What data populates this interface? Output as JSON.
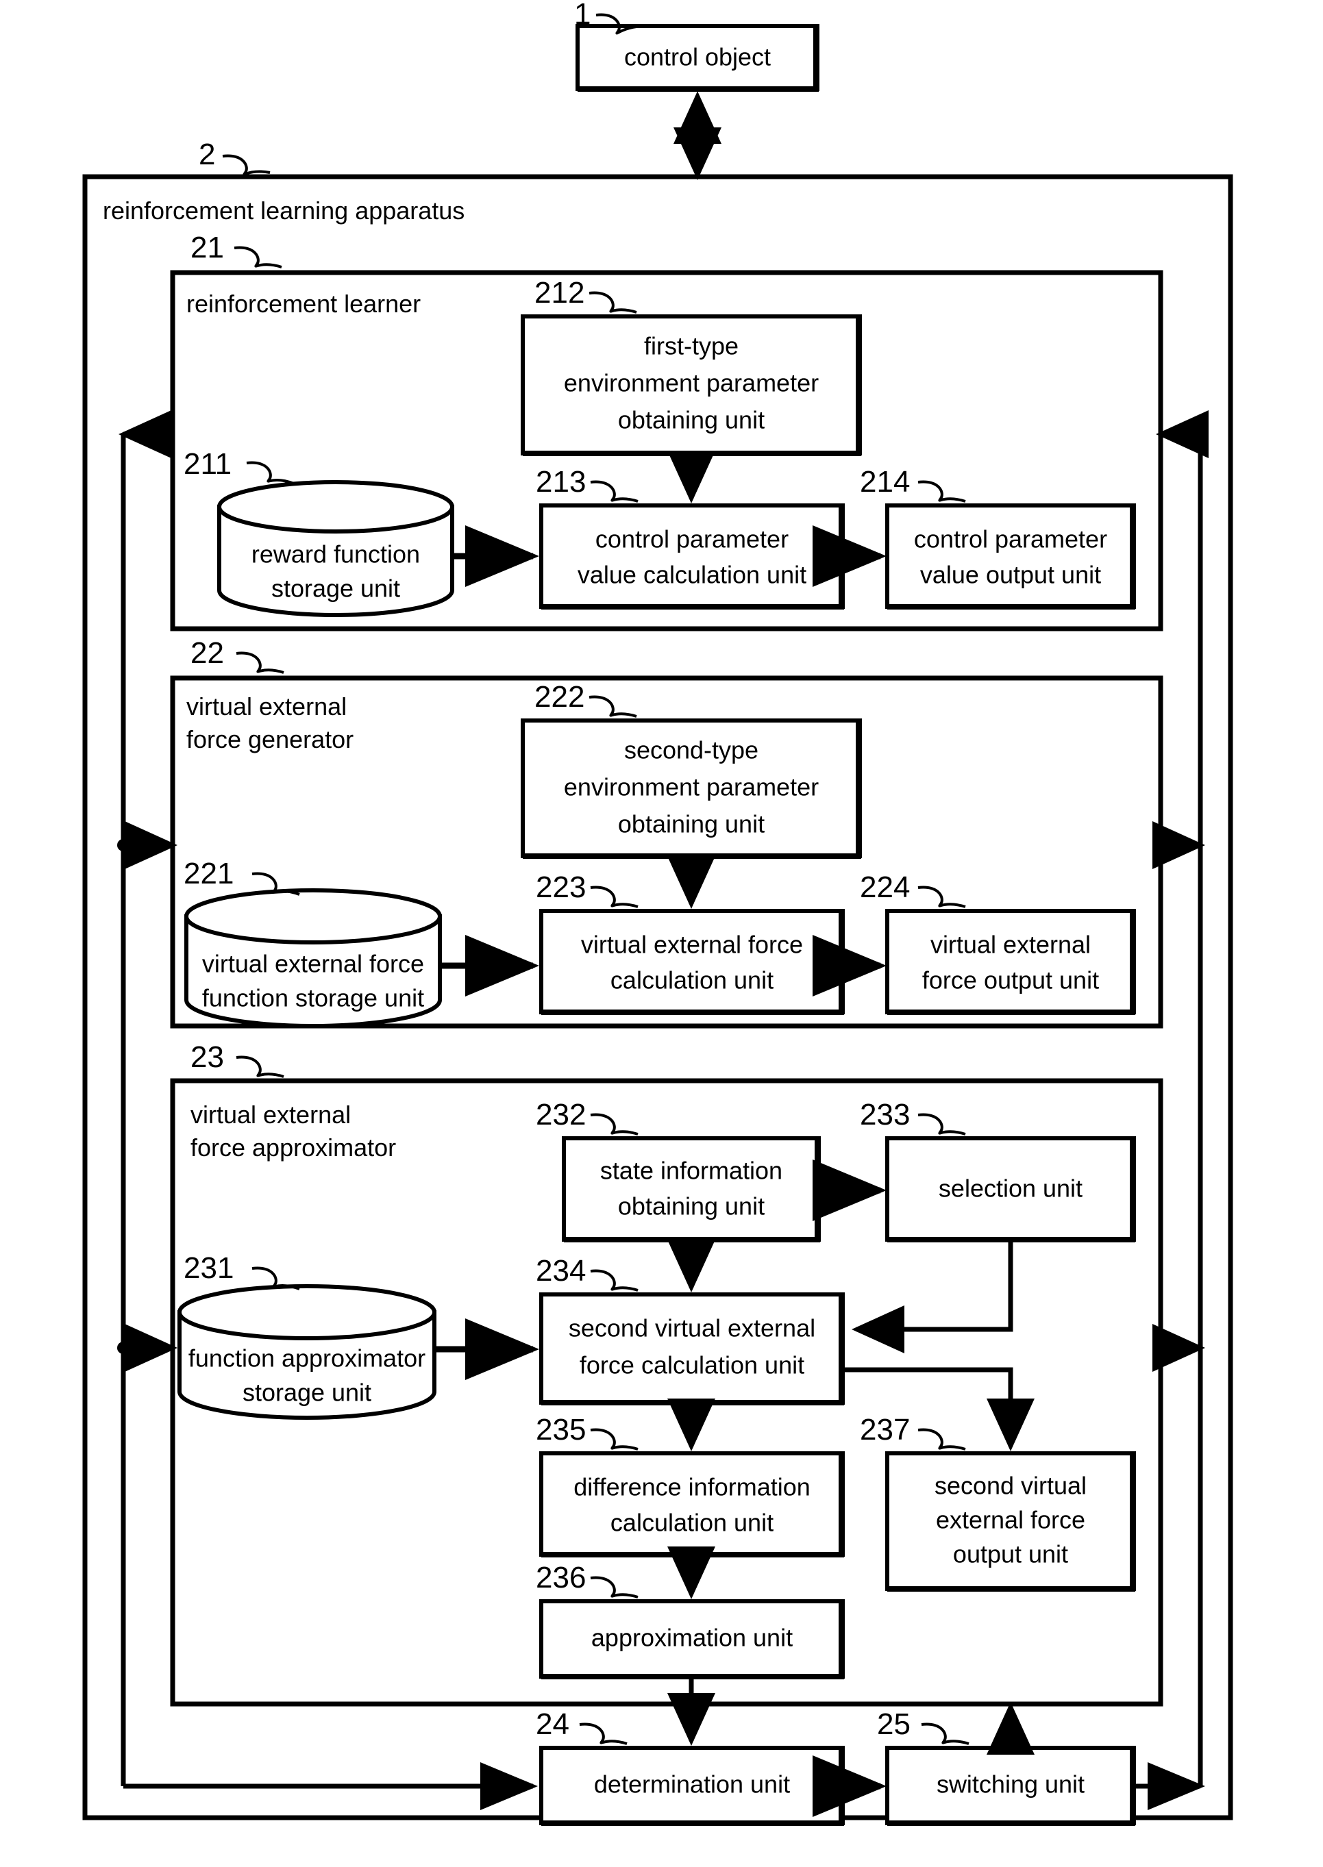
{
  "diagram": {
    "title": "reinforcement learning apparatus block diagram",
    "line_color": "#000000",
    "background": "#ffffff",
    "top_block": {
      "ref": "1",
      "label": "control object"
    },
    "apparatus": {
      "ref": "2",
      "label": "reinforcement learning apparatus"
    },
    "sections": [
      {
        "ref": "21",
        "label": "reinforcement learner",
        "label_lines": [
          "reinforcement learner"
        ],
        "blocks": [
          {
            "ref": "211",
            "shape": "cylinder",
            "lines": [
              "reward function",
              "storage unit"
            ]
          },
          {
            "ref": "212",
            "shape": "rect",
            "lines": [
              "first-type",
              "environment parameter",
              "obtaining unit"
            ]
          },
          {
            "ref": "213",
            "shape": "rect",
            "lines": [
              "control parameter",
              "value calculation unit"
            ]
          },
          {
            "ref": "214",
            "shape": "rect",
            "lines": [
              "control parameter",
              "value output unit"
            ]
          }
        ]
      },
      {
        "ref": "22",
        "label": "virtual external force generator",
        "label_lines": [
          "virtual external",
          "force generator"
        ],
        "blocks": [
          {
            "ref": "221",
            "shape": "cylinder",
            "lines": [
              "virtual external force",
              "function storage unit"
            ]
          },
          {
            "ref": "222",
            "shape": "rect",
            "lines": [
              "second-type",
              "environment parameter",
              "obtaining unit"
            ]
          },
          {
            "ref": "223",
            "shape": "rect",
            "lines": [
              "virtual external force",
              "calculation unit"
            ]
          },
          {
            "ref": "224",
            "shape": "rect",
            "lines": [
              "virtual external",
              "force output unit"
            ]
          }
        ]
      },
      {
        "ref": "23",
        "label": "virtual external force approximator",
        "label_lines": [
          "virtual external",
          "force approximator"
        ],
        "blocks": [
          {
            "ref": "231",
            "shape": "cylinder",
            "lines": [
              "function approximator",
              "storage unit"
            ]
          },
          {
            "ref": "232",
            "shape": "rect",
            "lines": [
              "state information",
              "obtaining unit"
            ]
          },
          {
            "ref": "233",
            "shape": "rect",
            "lines": [
              "selection unit"
            ]
          },
          {
            "ref": "234",
            "shape": "rect",
            "lines": [
              "second virtual external",
              "force calculation unit"
            ]
          },
          {
            "ref": "235",
            "shape": "rect",
            "lines": [
              "difference information",
              "calculation unit"
            ]
          },
          {
            "ref": "236",
            "shape": "rect",
            "lines": [
              "approximation unit"
            ]
          },
          {
            "ref": "237",
            "shape": "rect",
            "lines": [
              "second virtual",
              "external force",
              "output unit"
            ]
          }
        ]
      }
    ],
    "bottom_blocks": [
      {
        "ref": "24",
        "shape": "rect",
        "lines": [
          "determination unit"
        ]
      },
      {
        "ref": "25",
        "shape": "rect",
        "lines": [
          "switching unit"
        ]
      }
    ]
  }
}
